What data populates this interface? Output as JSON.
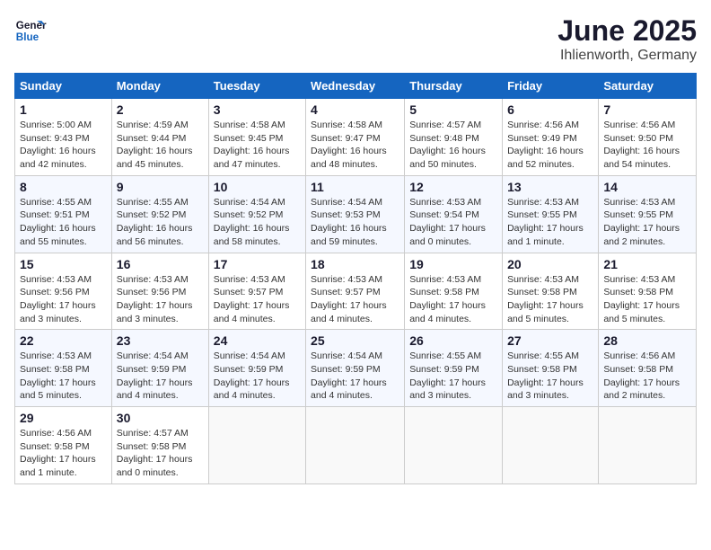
{
  "logo": {
    "line1": "General",
    "line2": "Blue"
  },
  "title": "June 2025",
  "location": "Ihlienworth, Germany",
  "weekdays": [
    "Sunday",
    "Monday",
    "Tuesday",
    "Wednesday",
    "Thursday",
    "Friday",
    "Saturday"
  ],
  "weeks": [
    [
      {
        "day": "1",
        "info": "Sunrise: 5:00 AM\nSunset: 9:43 PM\nDaylight: 16 hours\nand 42 minutes."
      },
      {
        "day": "2",
        "info": "Sunrise: 4:59 AM\nSunset: 9:44 PM\nDaylight: 16 hours\nand 45 minutes."
      },
      {
        "day": "3",
        "info": "Sunrise: 4:58 AM\nSunset: 9:45 PM\nDaylight: 16 hours\nand 47 minutes."
      },
      {
        "day": "4",
        "info": "Sunrise: 4:58 AM\nSunset: 9:47 PM\nDaylight: 16 hours\nand 48 minutes."
      },
      {
        "day": "5",
        "info": "Sunrise: 4:57 AM\nSunset: 9:48 PM\nDaylight: 16 hours\nand 50 minutes."
      },
      {
        "day": "6",
        "info": "Sunrise: 4:56 AM\nSunset: 9:49 PM\nDaylight: 16 hours\nand 52 minutes."
      },
      {
        "day": "7",
        "info": "Sunrise: 4:56 AM\nSunset: 9:50 PM\nDaylight: 16 hours\nand 54 minutes."
      }
    ],
    [
      {
        "day": "8",
        "info": "Sunrise: 4:55 AM\nSunset: 9:51 PM\nDaylight: 16 hours\nand 55 minutes."
      },
      {
        "day": "9",
        "info": "Sunrise: 4:55 AM\nSunset: 9:52 PM\nDaylight: 16 hours\nand 56 minutes."
      },
      {
        "day": "10",
        "info": "Sunrise: 4:54 AM\nSunset: 9:52 PM\nDaylight: 16 hours\nand 58 minutes."
      },
      {
        "day": "11",
        "info": "Sunrise: 4:54 AM\nSunset: 9:53 PM\nDaylight: 16 hours\nand 59 minutes."
      },
      {
        "day": "12",
        "info": "Sunrise: 4:53 AM\nSunset: 9:54 PM\nDaylight: 17 hours\nand 0 minutes."
      },
      {
        "day": "13",
        "info": "Sunrise: 4:53 AM\nSunset: 9:55 PM\nDaylight: 17 hours\nand 1 minute."
      },
      {
        "day": "14",
        "info": "Sunrise: 4:53 AM\nSunset: 9:55 PM\nDaylight: 17 hours\nand 2 minutes."
      }
    ],
    [
      {
        "day": "15",
        "info": "Sunrise: 4:53 AM\nSunset: 9:56 PM\nDaylight: 17 hours\nand 3 minutes."
      },
      {
        "day": "16",
        "info": "Sunrise: 4:53 AM\nSunset: 9:56 PM\nDaylight: 17 hours\nand 3 minutes."
      },
      {
        "day": "17",
        "info": "Sunrise: 4:53 AM\nSunset: 9:57 PM\nDaylight: 17 hours\nand 4 minutes."
      },
      {
        "day": "18",
        "info": "Sunrise: 4:53 AM\nSunset: 9:57 PM\nDaylight: 17 hours\nand 4 minutes."
      },
      {
        "day": "19",
        "info": "Sunrise: 4:53 AM\nSunset: 9:58 PM\nDaylight: 17 hours\nand 4 minutes."
      },
      {
        "day": "20",
        "info": "Sunrise: 4:53 AM\nSunset: 9:58 PM\nDaylight: 17 hours\nand 5 minutes."
      },
      {
        "day": "21",
        "info": "Sunrise: 4:53 AM\nSunset: 9:58 PM\nDaylight: 17 hours\nand 5 minutes."
      }
    ],
    [
      {
        "day": "22",
        "info": "Sunrise: 4:53 AM\nSunset: 9:58 PM\nDaylight: 17 hours\nand 5 minutes."
      },
      {
        "day": "23",
        "info": "Sunrise: 4:54 AM\nSunset: 9:59 PM\nDaylight: 17 hours\nand 4 minutes."
      },
      {
        "day": "24",
        "info": "Sunrise: 4:54 AM\nSunset: 9:59 PM\nDaylight: 17 hours\nand 4 minutes."
      },
      {
        "day": "25",
        "info": "Sunrise: 4:54 AM\nSunset: 9:59 PM\nDaylight: 17 hours\nand 4 minutes."
      },
      {
        "day": "26",
        "info": "Sunrise: 4:55 AM\nSunset: 9:59 PM\nDaylight: 17 hours\nand 3 minutes."
      },
      {
        "day": "27",
        "info": "Sunrise: 4:55 AM\nSunset: 9:58 PM\nDaylight: 17 hours\nand 3 minutes."
      },
      {
        "day": "28",
        "info": "Sunrise: 4:56 AM\nSunset: 9:58 PM\nDaylight: 17 hours\nand 2 minutes."
      }
    ],
    [
      {
        "day": "29",
        "info": "Sunrise: 4:56 AM\nSunset: 9:58 PM\nDaylight: 17 hours\nand 1 minute."
      },
      {
        "day": "30",
        "info": "Sunrise: 4:57 AM\nSunset: 9:58 PM\nDaylight: 17 hours\nand 0 minutes."
      },
      null,
      null,
      null,
      null,
      null
    ]
  ]
}
